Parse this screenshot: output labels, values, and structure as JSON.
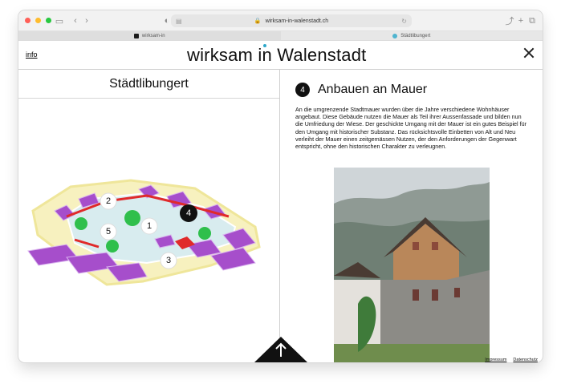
{
  "browser": {
    "url": "wirksam-in-walenstadt.ch",
    "tabs": [
      {
        "label": "wirksam-in",
        "active": true
      },
      {
        "label": "Städtlibungert",
        "active": false
      }
    ]
  },
  "header": {
    "info_label": "info",
    "logo_text_part1": "wirksam",
    "logo_text_part2": "in",
    "logo_text_part3": "Walenstadt",
    "accent_color": "#2ea7c9"
  },
  "left": {
    "title": "Städtlibungert",
    "map_labels": [
      "1",
      "2",
      "3",
      "4",
      "5"
    ]
  },
  "right": {
    "number": "4",
    "heading": "Anbauen an Mauer",
    "text": "An die umgrenzende Stadtmauer wurden über die Jahre verschiedene Wohnhäuser angebaut. Diese Gebäude nutzen die Mauer als Teil ihrer Aussenfassade und bilden nun die Umfriedung der Wiese. Der geschickte Umgang mit der Mauer ist ein gutes Beispiel für den Umgang mit histori­scher Substanz. Das rücksichtsvolle Einbetten von Alt und Neu verleiht der Mauer einen zeitgemässen Nutzen, der den Anforderungen der Ge­genwart entspricht, ohne den historischen Charakter zu verleugnen."
  },
  "footer": {
    "links": [
      "Impressum",
      "Datenschutz"
    ]
  }
}
